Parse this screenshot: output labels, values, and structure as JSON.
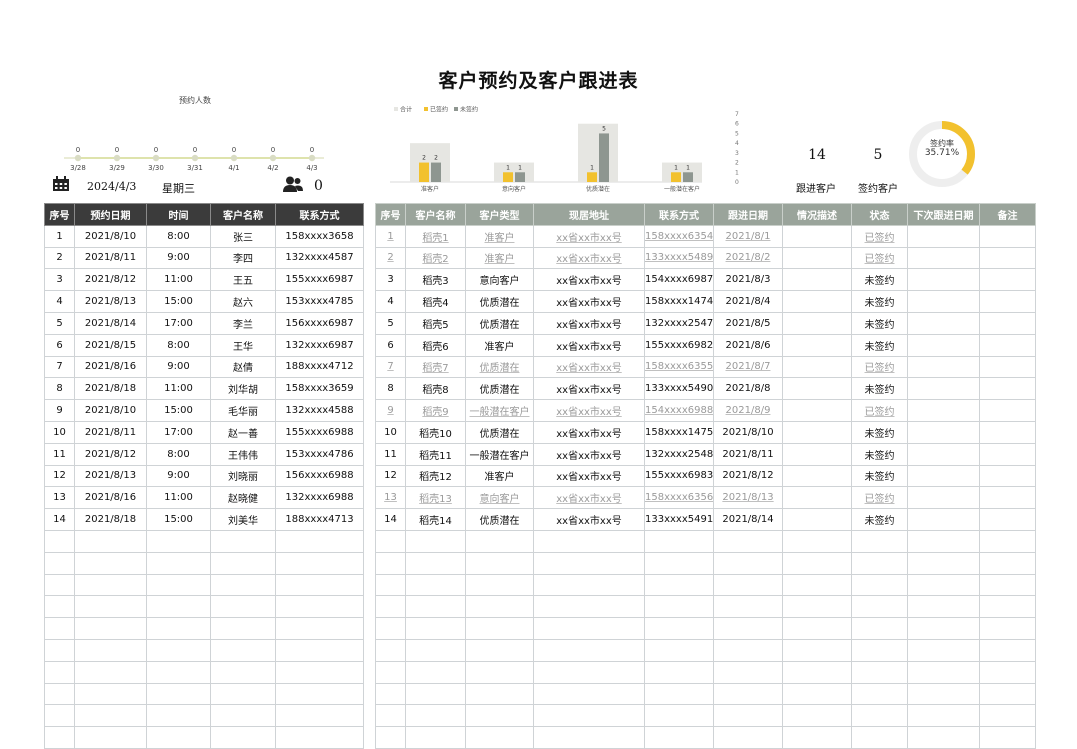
{
  "title": "客户预约及客户跟进表",
  "line_chart": {
    "title": "预约人数",
    "chart_data": {
      "type": "line",
      "categories": [
        "3/28",
        "3/29",
        "3/30",
        "3/31",
        "4/1",
        "4/2",
        "4/3"
      ],
      "values": [
        0,
        0,
        0,
        0,
        0,
        0,
        0
      ]
    }
  },
  "calendar": {
    "date": "2024/4/3",
    "weekday": "星期三",
    "appointment_count": "0"
  },
  "bar_chart": {
    "legend": [
      "合计",
      "已签约",
      "未签约"
    ],
    "y_ticks": [
      "7",
      "6",
      "5",
      "4",
      "3",
      "2",
      "1",
      "0"
    ],
    "chart_data": {
      "type": "bar",
      "categories": [
        "准客户",
        "意向客户",
        "优质潜在",
        "一般潜在客户"
      ],
      "series": [
        {
          "name": "合计",
          "values": [
            4,
            2,
            6,
            2
          ]
        },
        {
          "name": "已签约",
          "values": [
            2,
            1,
            1,
            1
          ]
        },
        {
          "name": "未签约",
          "values": [
            2,
            1,
            5,
            1
          ]
        }
      ],
      "ylim": [
        0,
        7
      ]
    },
    "colors": {
      "total": "#e6e6e2",
      "signed": "#f2c12e",
      "unsigned": "#8e9690"
    }
  },
  "kpis": {
    "followed": {
      "value": "14",
      "label": "跟进客户"
    },
    "signed": {
      "value": "5",
      "label": "签约客户"
    },
    "rate": {
      "label": "签约率",
      "value": "35.71%",
      "fraction": 0.3571
    }
  },
  "left_table": {
    "headers": [
      "序号",
      "预约日期",
      "时间",
      "客户名称",
      "联系方式"
    ],
    "rows": [
      [
        "1",
        "2021/8/10",
        "8:00",
        "张三",
        "158xxxx3658"
      ],
      [
        "2",
        "2021/8/11",
        "9:00",
        "李四",
        "132xxxx4587"
      ],
      [
        "3",
        "2021/8/12",
        "11:00",
        "王五",
        "155xxxx6987"
      ],
      [
        "4",
        "2021/8/13",
        "15:00",
        "赵六",
        "153xxxx4785"
      ],
      [
        "5",
        "2021/8/14",
        "17:00",
        "李兰",
        "156xxxx6987"
      ],
      [
        "6",
        "2021/8/15",
        "8:00",
        "王华",
        "132xxxx6987"
      ],
      [
        "7",
        "2021/8/16",
        "9:00",
        "赵倩",
        "188xxxx4712"
      ],
      [
        "8",
        "2021/8/18",
        "11:00",
        "刘华胡",
        "158xxxx3659"
      ],
      [
        "9",
        "2021/8/10",
        "15:00",
        "毛华丽",
        "132xxxx4588"
      ],
      [
        "10",
        "2021/8/11",
        "17:00",
        "赵一善",
        "155xxxx6988"
      ],
      [
        "11",
        "2021/8/12",
        "8:00",
        "王伟伟",
        "153xxxx4786"
      ],
      [
        "12",
        "2021/8/13",
        "9:00",
        "刘晓丽",
        "156xxxx6988"
      ],
      [
        "13",
        "2021/8/16",
        "11:00",
        "赵晓健",
        "132xxxx6988"
      ],
      [
        "14",
        "2021/8/18",
        "15:00",
        "刘美华",
        "188xxxx4713"
      ]
    ],
    "empty_rows": 10
  },
  "right_table": {
    "headers": [
      "序号",
      "客户名称",
      "客户类型",
      "现居地址",
      "联系方式",
      "跟进日期",
      "情况描述",
      "状态",
      "下次跟进日期",
      "备注"
    ],
    "rows": [
      [
        "1",
        "稻壳1",
        "准客户",
        "xx省xx市xx号",
        "158xxxx6354",
        "2021/8/1",
        "",
        "已签约",
        "",
        ""
      ],
      [
        "2",
        "稻壳2",
        "准客户",
        "xx省xx市xx号",
        "133xxxx5489",
        "2021/8/2",
        "",
        "已签约",
        "",
        ""
      ],
      [
        "3",
        "稻壳3",
        "意向客户",
        "xx省xx市xx号",
        "154xxxx6987",
        "2021/8/3",
        "",
        "未签约",
        "",
        ""
      ],
      [
        "4",
        "稻壳4",
        "优质潜在",
        "xx省xx市xx号",
        "158xxxx1474",
        "2021/8/4",
        "",
        "未签约",
        "",
        ""
      ],
      [
        "5",
        "稻壳5",
        "优质潜在",
        "xx省xx市xx号",
        "132xxxx2547",
        "2021/8/5",
        "",
        "未签约",
        "",
        ""
      ],
      [
        "6",
        "稻壳6",
        "准客户",
        "xx省xx市xx号",
        "155xxxx6982",
        "2021/8/6",
        "",
        "未签约",
        "",
        ""
      ],
      [
        "7",
        "稻壳7",
        "优质潜在",
        "xx省xx市xx号",
        "158xxxx6355",
        "2021/8/7",
        "",
        "已签约",
        "",
        ""
      ],
      [
        "8",
        "稻壳8",
        "优质潜在",
        "xx省xx市xx号",
        "133xxxx5490",
        "2021/8/8",
        "",
        "未签约",
        "",
        ""
      ],
      [
        "9",
        "稻壳9",
        "一般潜在客户",
        "xx省xx市xx号",
        "154xxxx6988",
        "2021/8/9",
        "",
        "已签约",
        "",
        ""
      ],
      [
        "10",
        "稻壳10",
        "优质潜在",
        "xx省xx市xx号",
        "158xxxx1475",
        "2021/8/10",
        "",
        "未签约",
        "",
        ""
      ],
      [
        "11",
        "稻壳11",
        "一般潜在客户",
        "xx省xx市xx号",
        "132xxxx2548",
        "2021/8/11",
        "",
        "未签约",
        "",
        ""
      ],
      [
        "12",
        "稻壳12",
        "准客户",
        "xx省xx市xx号",
        "155xxxx6983",
        "2021/8/12",
        "",
        "未签约",
        "",
        ""
      ],
      [
        "13",
        "稻壳13",
        "意向客户",
        "xx省xx市xx号",
        "158xxxx6356",
        "2021/8/13",
        "",
        "已签约",
        "",
        ""
      ],
      [
        "14",
        "稻壳14",
        "优质潜在",
        "xx省xx市xx号",
        "133xxxx5491",
        "2021/8/14",
        "",
        "未签约",
        "",
        ""
      ]
    ],
    "signed_status": "已签约",
    "empty_rows": 10
  }
}
